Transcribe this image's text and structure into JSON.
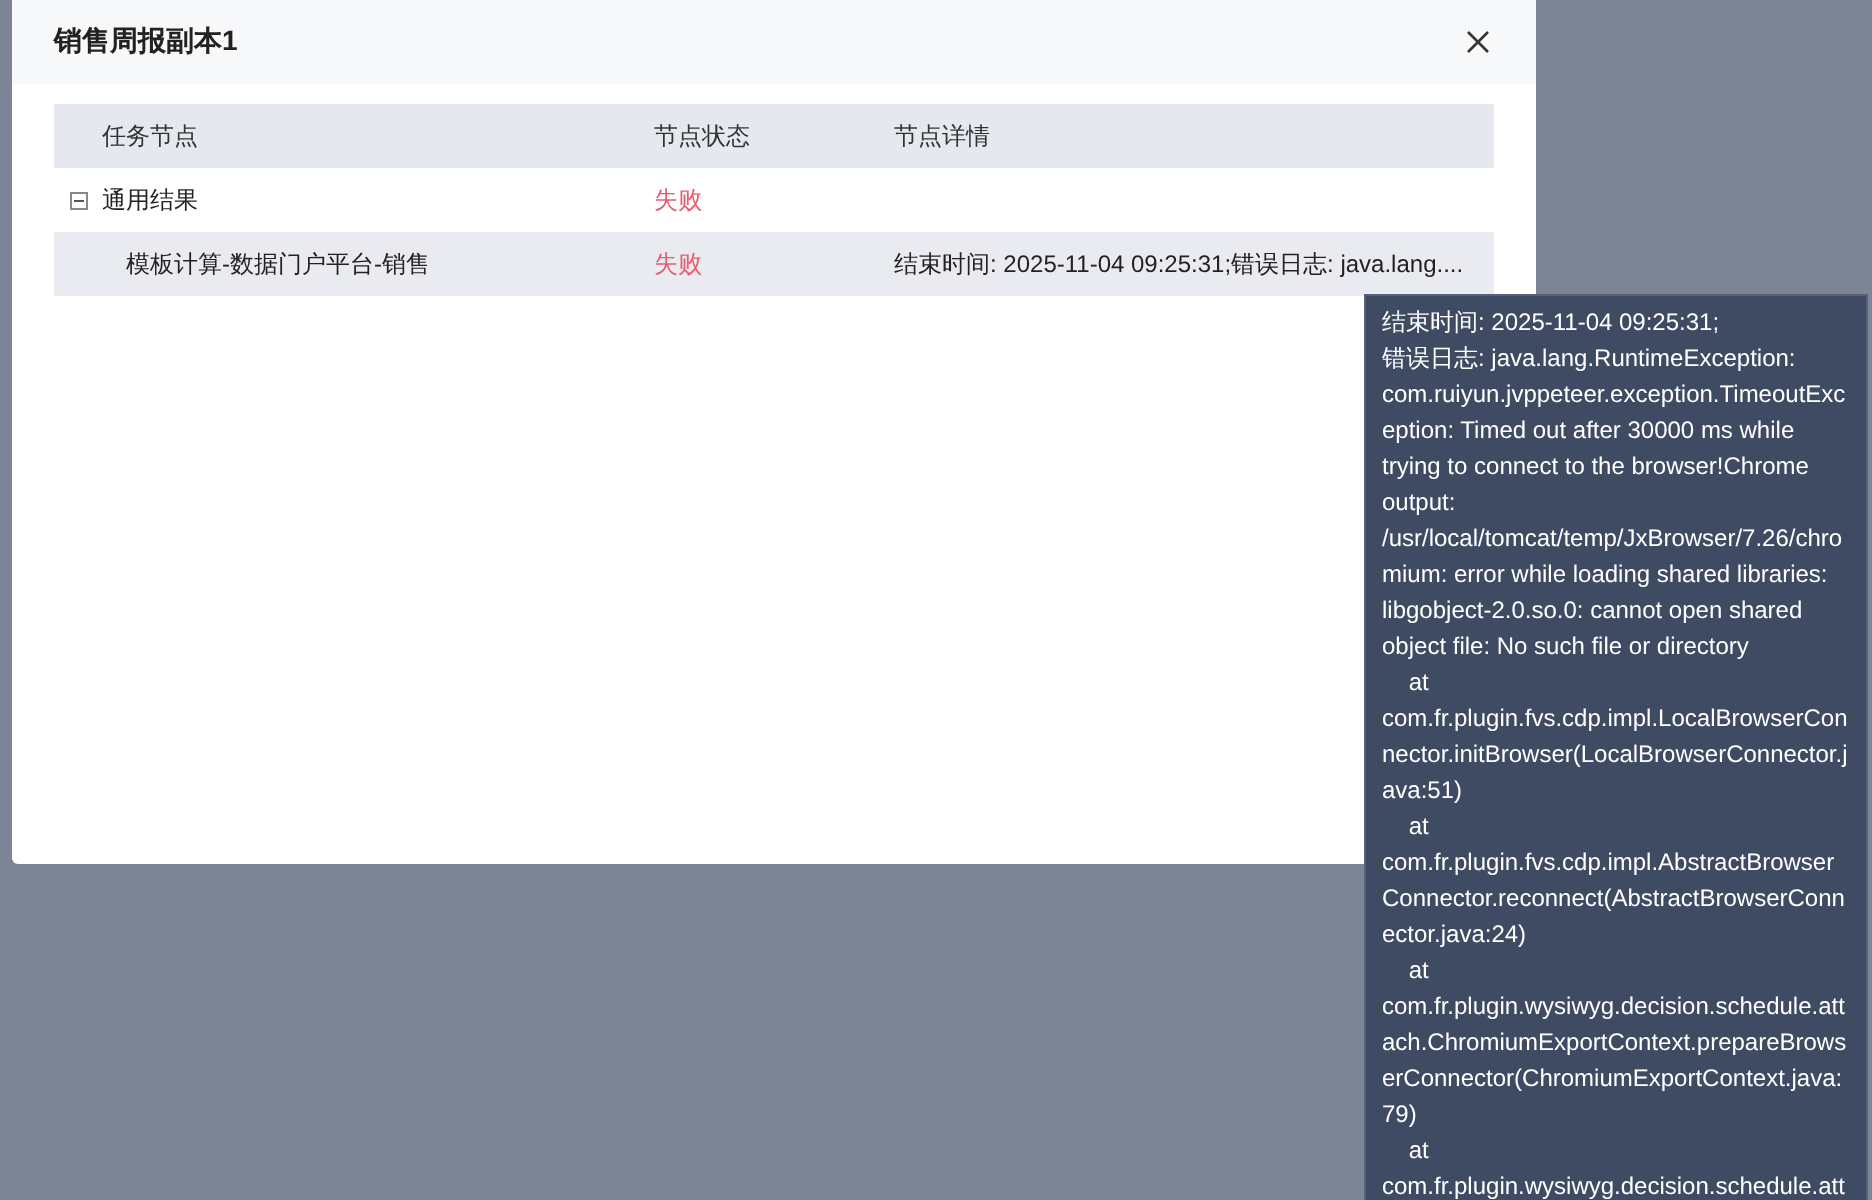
{
  "dialog": {
    "title": "销售周报副本1"
  },
  "table": {
    "columns": [
      "任务节点",
      "节点状态",
      "节点详情"
    ],
    "rows": [
      {
        "name": "通用结果",
        "status": "失败",
        "detail": "",
        "expanded": true,
        "highlighted": false,
        "children": [
          {
            "name": "模板计算-数据门户平台-销售",
            "status": "失败",
            "detail": "结束时间: 2025-11-04 09:25:31;错误日志: java.lang....",
            "highlighted": true
          }
        ]
      }
    ]
  },
  "tooltip": {
    "lines": [
      "结束时间: 2025-11-04 09:25:31;",
      "错误日志: java.lang.RuntimeException:",
      "com.ruiyun.jvppeteer.exception.TimeoutExc",
      "eption: Timed out after 30000 ms while",
      "trying to connect to the browser!Chrome",
      "output:",
      "/usr/local/tomcat/temp/JxBrowser/7.26/chro",
      "mium: error while loading shared libraries:",
      "libgobject-2.0.so.0: cannot open shared",
      "object file: No such file or directory",
      "\tat",
      "com.fr.plugin.fvs.cdp.impl.LocalBrowserCon",
      "nector.initBrowser(LocalBrowserConnector.j",
      "ava:51)",
      "\tat",
      "com.fr.plugin.fvs.cdp.impl.AbstractBrowser",
      "Connector.reconnect(AbstractBrowserConn",
      "ector.java:24)",
      "\tat",
      "com.fr.plugin.wysiwyg.decision.schedule.att",
      "ach.ChromiumExportContext.prepareBrows",
      "erConnector(ChromiumExportContext.java:",
      "79)",
      "\tat",
      "com.fr.plugin.wysiwyg.decision.schedule.att"
    ]
  }
}
